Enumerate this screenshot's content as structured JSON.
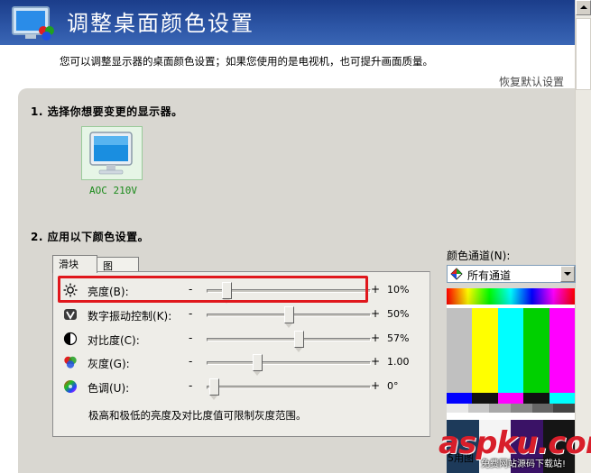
{
  "header": {
    "title": "调整桌面颜色设置",
    "restore_link": "恢复默认设置"
  },
  "intro_text": "您可以调整显示器的桌面颜色设置；如果您使用的是电视机，也可提升画面质量。",
  "section1": {
    "heading": "1. 选择你想要变更的显示器。",
    "monitor_label": "AOC 210V"
  },
  "section2": {
    "heading": "2. 应用以下颜色设置。",
    "tabs": [
      {
        "label": "滑块",
        "active": true
      },
      {
        "label": "图",
        "active": false
      }
    ],
    "sliders": [
      {
        "icon": "sun-icon",
        "label": "亮度(B):",
        "minus": "-",
        "plus": "+",
        "value": "10%",
        "fraction": 0.1
      },
      {
        "icon": "digital-vibrance-icon",
        "label": "数字振动控制(K):",
        "minus": "-",
        "plus": "+",
        "value": "50%",
        "fraction": 0.5
      },
      {
        "icon": "contrast-icon",
        "label": "对比度(C):",
        "minus": "-",
        "plus": "+",
        "value": "57%",
        "fraction": 0.57
      },
      {
        "icon": "gamma-icon",
        "label": "灰度(G):",
        "minus": "-",
        "plus": "+",
        "value": "1.00",
        "fraction": 0.3
      },
      {
        "icon": "hue-icon",
        "label": "色调(U):",
        "minus": "-",
        "plus": "+",
        "value": "0°",
        "fraction": 0.02
      }
    ],
    "note": "极高和极低的亮度及对比度值可限制灰度范围。"
  },
  "color_channel": {
    "label": "颜色通道(N):",
    "selected": "所有通道"
  },
  "preview": {
    "caption": "5用图"
  },
  "watermark": {
    "brand": "aspku.com",
    "sub": "免费网站源码下载站!"
  },
  "colors": {
    "header_bg": "#2d56a6",
    "highlight": "#e0171c",
    "panel_bg": "#d9d7d1",
    "monitor_label": "#1a8a1a"
  }
}
